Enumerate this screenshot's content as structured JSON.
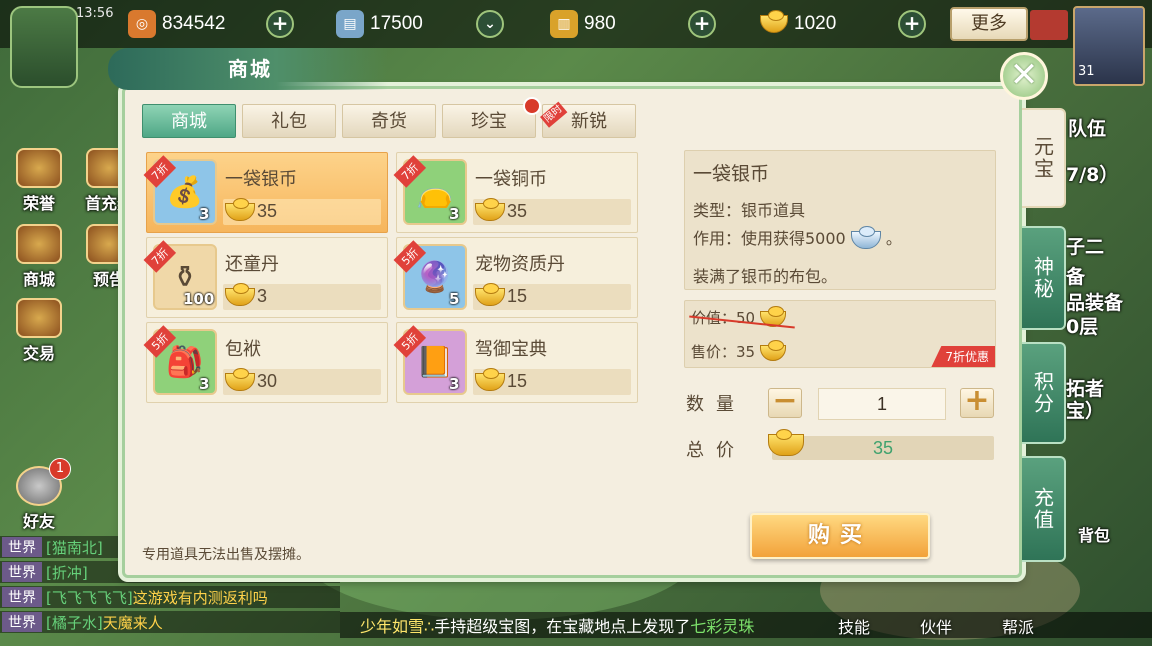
{
  "status": {
    "time": "13:56"
  },
  "resources": [
    {
      "icon": "copper-coin-icon",
      "value": "834542",
      "color": "#d9792e"
    },
    {
      "icon": "silver-note-icon",
      "value": "17500",
      "color": "#7aa6c9"
    },
    {
      "icon": "gold-scroll-icon",
      "value": "980",
      "color": "#d9a22a"
    },
    {
      "icon": "gold-ingot-icon",
      "value": "1020",
      "color": "#e0a219"
    }
  ],
  "more_label": "更多",
  "avatar_level": "31",
  "side_menu": [
    {
      "label": "荣誉",
      "icon": "honor-icon"
    },
    {
      "label": "首充奖",
      "icon": "first-charge-icon"
    },
    {
      "label": "商城",
      "icon": "shop-icon"
    },
    {
      "label": "预告",
      "icon": "preview-icon"
    },
    {
      "label": "交易",
      "icon": "trade-icon"
    },
    {
      "label": "好友",
      "icon": "friends-icon"
    }
  ],
  "friends_badge": "1",
  "bg_right_text": [
    "队伍",
    "7/8）",
    "子二",
    "备",
    "品装备",
    "0层",
    "拓者",
    "宝）",
    "背包"
  ],
  "chat": [
    {
      "channel": "世界",
      "name": "[猫南北]",
      "text": ""
    },
    {
      "channel": "世界",
      "name": "[折冲]",
      "text": ""
    },
    {
      "channel": "世界",
      "name": "[飞飞飞飞飞]",
      "text": "这游戏有内测返利吗"
    },
    {
      "channel": "世界",
      "name": "[橘子水]",
      "text": "天魔来人"
    }
  ],
  "ticker": {
    "name": "少年如雪∴",
    "text": "手持超级宝图，在宝藏地点上发现了",
    "item": "七彩灵珠"
  },
  "bottom_buttons": [
    "技能",
    "伙伴",
    "帮派"
  ],
  "shop": {
    "title": "商城",
    "tabs": [
      {
        "label": "商城",
        "active": true
      },
      {
        "label": "礼包",
        "active": false
      },
      {
        "label": "奇货",
        "active": false
      },
      {
        "label": "珍宝",
        "active": false,
        "dot": true
      },
      {
        "label": "新锐",
        "active": false,
        "tag": "限时"
      }
    ],
    "items": [
      {
        "name": "一袋银币",
        "discount": "7折",
        "qty": "3",
        "price": "35",
        "icon": "silver-bag-icon",
        "color": "#8ec5e8",
        "selected": true
      },
      {
        "name": "一袋铜币",
        "discount": "7折",
        "qty": "3",
        "price": "35",
        "icon": "copper-bag-icon",
        "color": "#8fd17a",
        "selected": false
      },
      {
        "name": "还童丹",
        "discount": "7折",
        "qty": "100",
        "price": "3",
        "icon": "rejuvenation-pill-icon",
        "color": "#f0d8a8",
        "selected": false
      },
      {
        "name": "宠物资质丹",
        "discount": "5折",
        "qty": "5",
        "price": "15",
        "icon": "pet-aptitude-pill-icon",
        "color": "#8ec5e8",
        "selected": false
      },
      {
        "name": "包袱",
        "discount": "5折",
        "qty": "3",
        "price": "30",
        "icon": "bundle-icon",
        "color": "#8fd17a",
        "selected": false
      },
      {
        "name": "驾御宝典",
        "discount": "5折",
        "qty": "3",
        "price": "15",
        "icon": "riding-manual-icon",
        "color": "#d4a0d8",
        "selected": false
      }
    ],
    "note": "专用道具无法出售及摆摊。",
    "detail": {
      "title": "一袋银币",
      "type_label": "类型：银币道具",
      "effect_label": "作用：使用获得5000",
      "effect_suffix": "。",
      "desc": "装满了银币的布包。"
    },
    "original_price": "价值：50",
    "sale_price": "售价：35",
    "sale_badge": "7折优惠",
    "quantity_label": "数量",
    "quantity": "1",
    "total_label": "总价",
    "total": "35",
    "buy_label": "购买",
    "side_tabs": [
      {
        "label": "元宝",
        "active": true
      },
      {
        "label": "神秘",
        "active": false
      },
      {
        "label": "积分",
        "active": false
      },
      {
        "label": "充值",
        "active": false
      }
    ]
  }
}
